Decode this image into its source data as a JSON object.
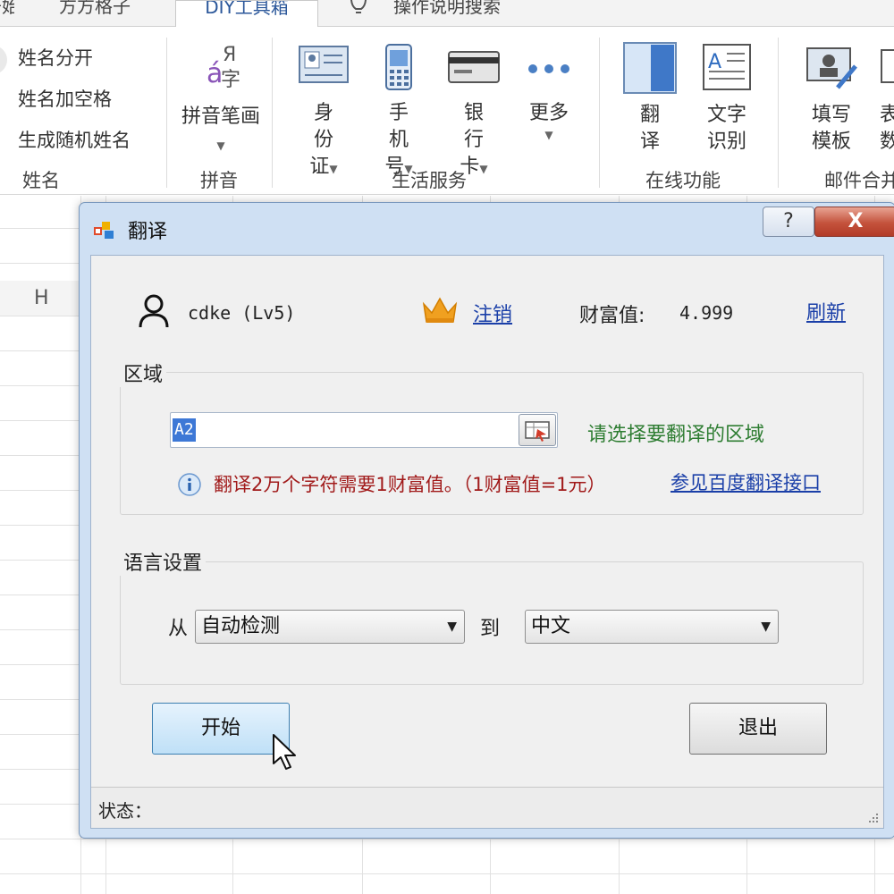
{
  "ribbon": {
    "tabs": [
      {
        "label": "开始"
      },
      {
        "label": "方方格子"
      },
      {
        "label": "DIY工具箱"
      },
      {
        "label": "操作说明搜索"
      }
    ],
    "name_group": {
      "label": "姓名",
      "items": [
        "姓名分开",
        "姓名加空格",
        "生成随机姓名"
      ]
    },
    "pinyin_group": {
      "label": "拼音",
      "buttons": [
        {
          "label": "拼音笔画"
        }
      ]
    },
    "life_group": {
      "label": "生活服务",
      "buttons": [
        {
          "label": "身份证"
        },
        {
          "label": "手机号"
        },
        {
          "label": "银行卡"
        },
        {
          "label": "更多"
        }
      ]
    },
    "online_group": {
      "label": "在线功能",
      "buttons": [
        {
          "label": "翻译"
        },
        {
          "label": "文字识别"
        }
      ]
    },
    "mail_group": {
      "label": "邮件合并",
      "buttons": [
        {
          "label": "填写模板"
        },
        {
          "label": "表数"
        }
      ]
    }
  },
  "sheet": {
    "column_header": "H"
  },
  "dialog": {
    "title": "翻译",
    "help_label": "?",
    "close_label": "X",
    "user": {
      "name": "cdke (Lv5)",
      "logout_label": "注销",
      "wealth_label": "财富值:",
      "wealth_value": "4.999",
      "refresh_label": "刷新"
    },
    "region": {
      "title": "区域",
      "range_value": "A2",
      "hint": "请选择要翻译的区域",
      "info": "翻译2万个字符需要1财富值。（1财富值=1元）",
      "api_link": "参见百度翻译接口"
    },
    "language": {
      "title": "语言设置",
      "from_label": "从",
      "from_value": "自动检测",
      "to_label": "到",
      "to_value": "中文"
    },
    "start_label": "开始",
    "exit_label": "退出",
    "status_label": "状态："
  },
  "colors": {
    "title_bar": "#cfe0f3",
    "close_button": "#c4523c",
    "link": "#1a3fa8",
    "hint_green": "#2e7d32",
    "info_red": "#a11a1a",
    "crown": "#f0a020"
  }
}
